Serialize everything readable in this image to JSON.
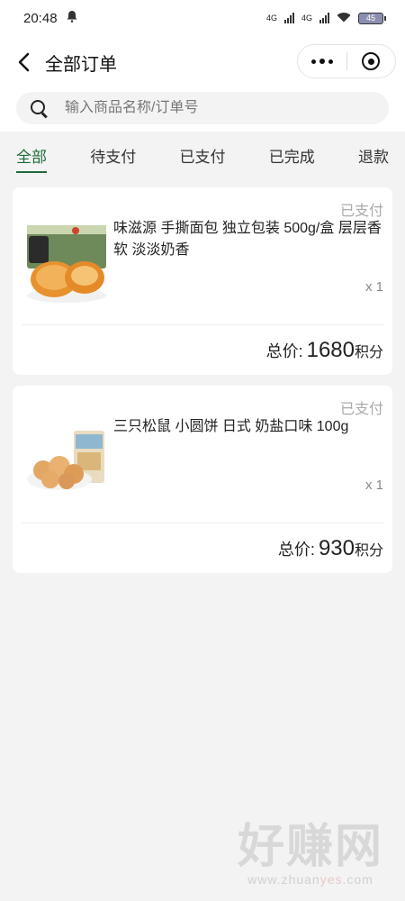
{
  "status_bar": {
    "time": "20:48",
    "signal1": "4G",
    "signal2": "4G",
    "battery": "45"
  },
  "nav": {
    "title": "全部订单"
  },
  "search": {
    "placeholder": "输入商品名称/订单号",
    "value": ""
  },
  "tabs": [
    {
      "label": "全部",
      "active": true
    },
    {
      "label": "待支付",
      "active": false
    },
    {
      "label": "已支付",
      "active": false
    },
    {
      "label": "已完成",
      "active": false
    },
    {
      "label": "退款",
      "active": false
    }
  ],
  "orders": [
    {
      "status": "已支付",
      "title": "味滋源 手撕面包 独立包装 500g/盒 层层香软 淡淡奶香",
      "qty": "x 1",
      "total_label": "总价:",
      "total_value": "1680",
      "total_unit": "积分"
    },
    {
      "status": "已支付",
      "title": "三只松鼠 小圆饼 日式 奶盐口味 100g",
      "qty": "x 1",
      "total_label": "总价:",
      "total_value": "930",
      "total_unit": "积分"
    }
  ],
  "watermark": {
    "text": "好赚网",
    "url_a": "www.zhuan",
    "url_b": "yes",
    "url_c": ".com"
  }
}
